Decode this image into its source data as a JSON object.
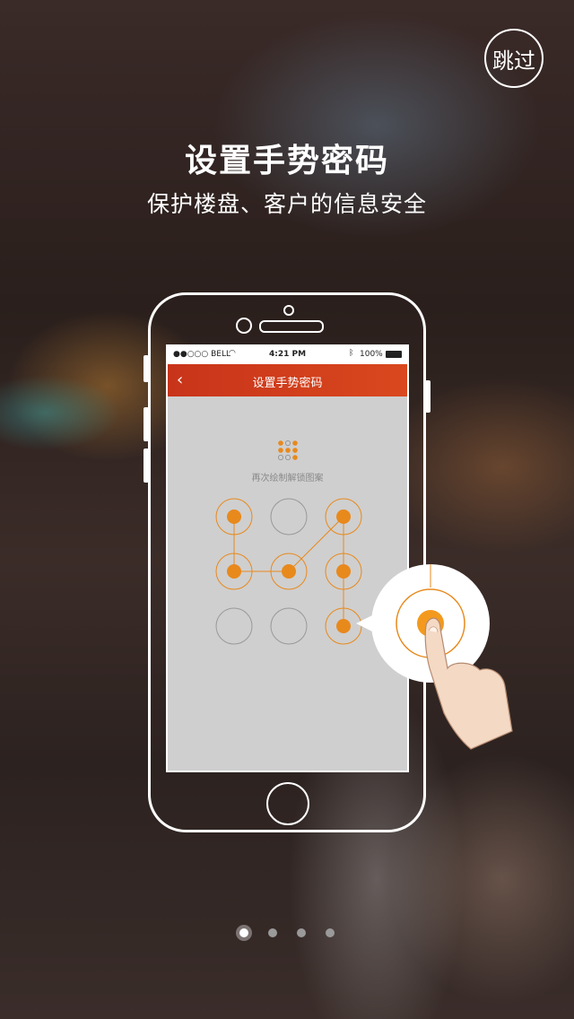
{
  "skip_label": "跳过",
  "title": "设置手势密码",
  "subtitle": "保护楼盘、客户的信息安全",
  "phone": {
    "status_bar": {
      "carrier": "●●○○○ BELL",
      "time": "4:21 PM",
      "battery": "100%"
    },
    "nav": {
      "back": "‹",
      "title": "设置手势密码"
    },
    "hint": "再次绘制解锁图案",
    "pattern_selected": [
      0,
      3,
      4,
      2,
      5,
      8
    ],
    "accent_color": "#e8891c"
  },
  "pager": {
    "count": 4,
    "active": 0
  }
}
